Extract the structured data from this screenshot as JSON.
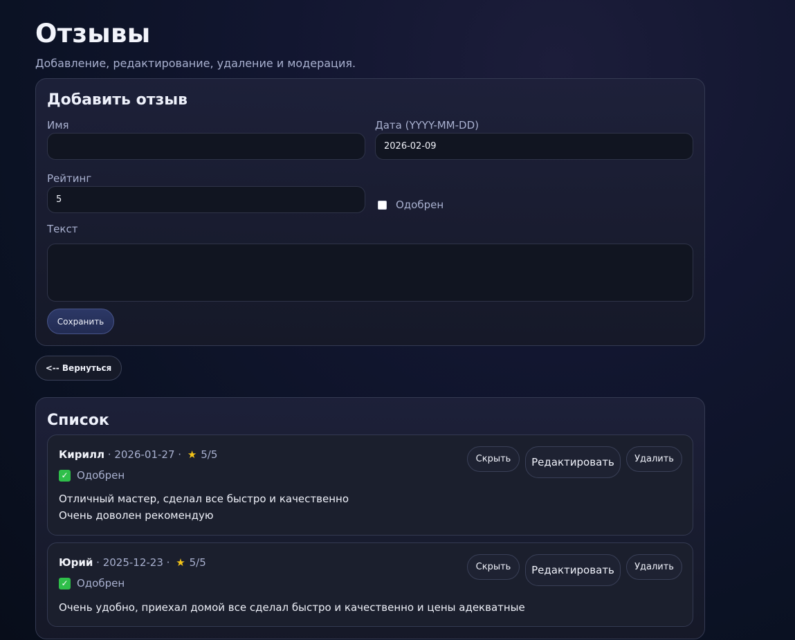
{
  "header": {
    "title": "Отзывы",
    "subtitle": "Добавление, редактирование, удаление и модерация."
  },
  "form": {
    "title": "Добавить отзыв",
    "name_label": "Имя",
    "name_value": "",
    "date_label": "Дата (YYYY-MM-DD)",
    "date_value": "2026-02-09",
    "rating_label": "Рейтинг",
    "rating_value": "5",
    "approved_label": "Одобрен",
    "approved_checked": false,
    "text_label": "Текст",
    "text_value": "",
    "save_label": "Сохранить"
  },
  "nav": {
    "back_label": "<-- Вернуться"
  },
  "list": {
    "title": "Список",
    "hide_label": "Скрыть",
    "edit_label": "Редактировать",
    "delete_label": "Удалить",
    "star_icon": "star-icon",
    "items": [
      {
        "author": "Кирилл",
        "date": "2026-01-27",
        "rating": "5/5",
        "status": "Одобрен",
        "text_lines": [
          "Отличный мастер, сделал все быстро и качественно",
          "Очень доволен рекомендую"
        ]
      },
      {
        "author": "Юрий",
        "date": "2025-12-23",
        "rating": "5/5",
        "status": "Одобрен",
        "text_lines": [
          "Очень удобно, приехал домой все сделал быстро и качественно и цены адекватные"
        ]
      }
    ]
  },
  "colors": {
    "accent_star": "#f5c518",
    "approved_green": "#2fbf4a",
    "save_button": "#2c3866"
  }
}
